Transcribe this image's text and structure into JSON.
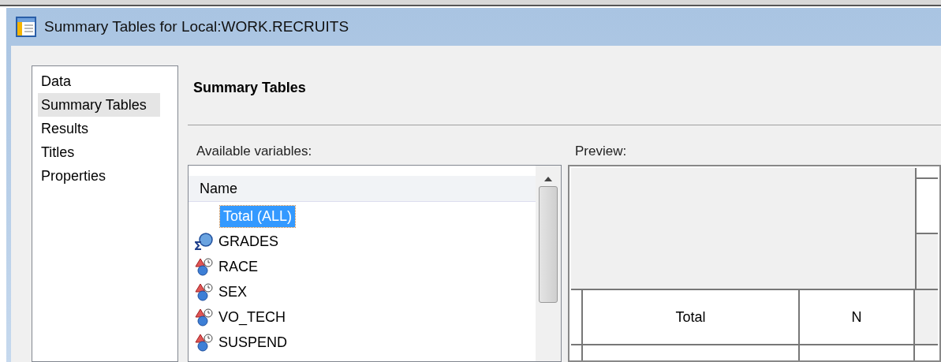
{
  "window": {
    "title": "Summary Tables for Local:WORK.RECRUITS"
  },
  "nav": {
    "items": [
      {
        "label": "Data",
        "selected": false
      },
      {
        "label": "Summary Tables",
        "selected": true
      },
      {
        "label": "Results",
        "selected": false
      },
      {
        "label": "Titles",
        "selected": false
      },
      {
        "label": "Properties",
        "selected": false
      }
    ]
  },
  "heading": "Summary Tables",
  "variables": {
    "label": "Available variables:",
    "column_header": "Name",
    "items": [
      {
        "label": "Total (ALL)",
        "kind": "total",
        "selected": true
      },
      {
        "label": "GRADES",
        "kind": "analysis",
        "selected": false
      },
      {
        "label": "RACE",
        "kind": "classification",
        "selected": false
      },
      {
        "label": "SEX",
        "kind": "classification",
        "selected": false
      },
      {
        "label": "VO_TECH",
        "kind": "classification",
        "selected": false
      },
      {
        "label": "SUSPEND",
        "kind": "classification",
        "selected": false
      }
    ]
  },
  "preview": {
    "label": "Preview:",
    "cells": [
      "Total",
      "N"
    ]
  }
}
